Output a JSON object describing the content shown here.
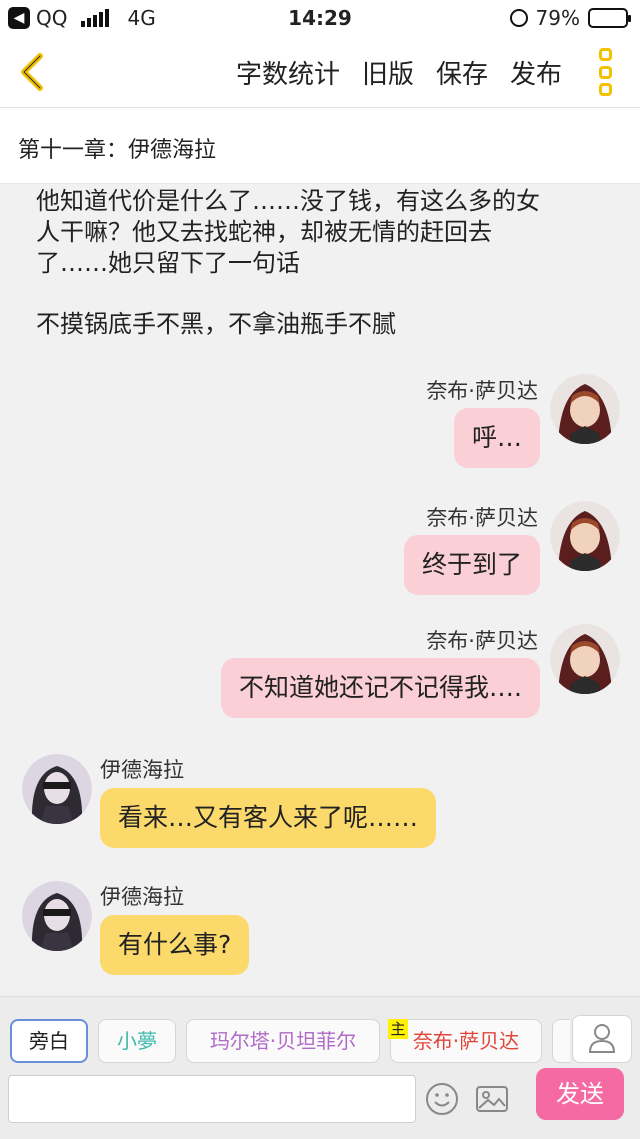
{
  "status_bar": {
    "carrier": "QQ",
    "network": "4G",
    "time": "14:29",
    "battery": "79%",
    "battery_level": 0.79
  },
  "nav": {
    "actions": [
      "字数统计",
      "旧版",
      "保存",
      "发布"
    ]
  },
  "chapter_title": "第十一章：伊德海拉",
  "narration": [
    {
      "lines": [
        "他知道代价是什么了……没了钱，有这么多的女",
        "人干嘛？他又去找蛇神，却被无情的赶回去",
        "了……她只留下了一句话"
      ]
    },
    {
      "lines": [
        "不摸锅底手不黑，不拿油瓶手不腻"
      ]
    }
  ],
  "messages": [
    {
      "side": "right",
      "name": "奈布·萨贝达",
      "text": "呼…",
      "color": "pink"
    },
    {
      "side": "right",
      "name": "奈布·萨贝达",
      "text": "终于到了",
      "color": "pink"
    },
    {
      "side": "right",
      "name": "奈布·萨贝达",
      "text": "不知道她还记不记得我….",
      "color": "pink"
    },
    {
      "side": "left",
      "name": "伊德海拉",
      "text": "看来…又有客人来了呢……",
      "color": "yellow"
    },
    {
      "side": "left",
      "name": "伊德海拉",
      "text": "有什么事?",
      "color": "yellow"
    }
  ],
  "characters": [
    {
      "label": "旁白",
      "color": "#222222",
      "active": true
    },
    {
      "label": "小夢",
      "color": "#3fb8a8"
    },
    {
      "label": "玛尔塔·贝坦菲尔",
      "color": "#b06ac8"
    },
    {
      "label": "奈布·萨贝达",
      "color": "#e0453a",
      "main_tag": "主"
    }
  ],
  "composer": {
    "placeholder": "",
    "send_label": "发送"
  },
  "icons": {
    "back": "chevron-left-icon",
    "menu": "more-vertical-icon",
    "emoji": "smiley-icon",
    "image": "image-icon",
    "character": "person-icon"
  },
  "colors": {
    "accent": "#f2c200",
    "send": "#f66aa3",
    "bubble_pink": "#fbcfd6",
    "bubble_yellow": "#fbd96a"
  }
}
